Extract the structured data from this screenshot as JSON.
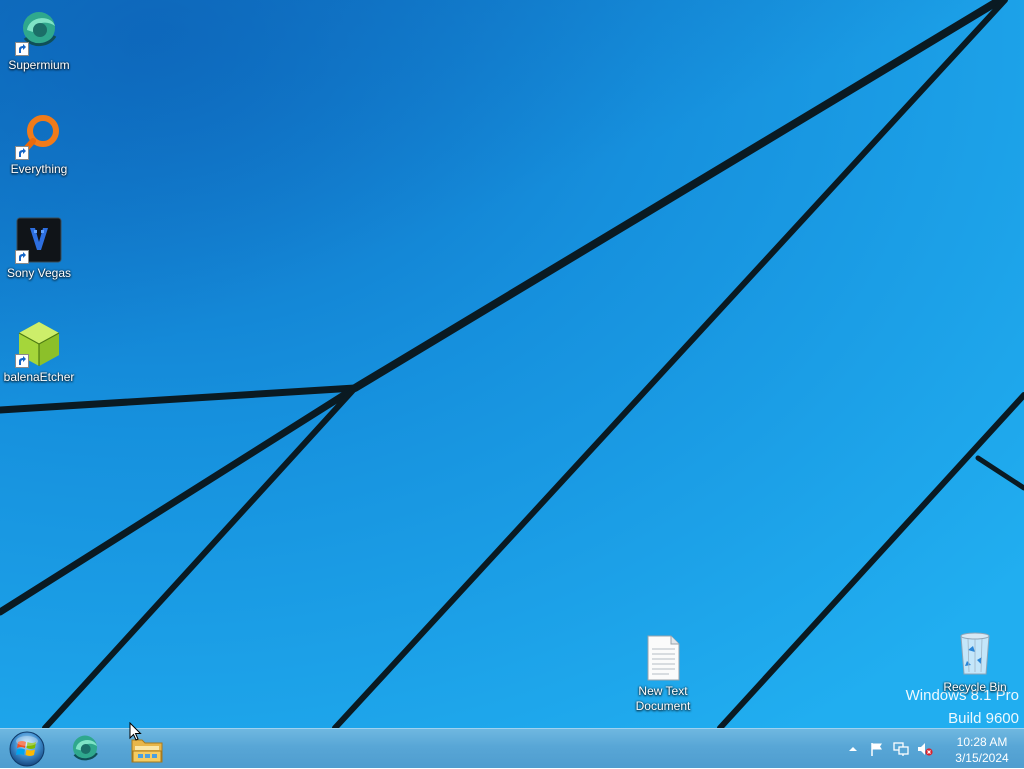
{
  "desktop": {
    "icons": [
      {
        "label": "Supermium",
        "icon": "supermium-icon"
      },
      {
        "label": "Everything",
        "icon": "everything-search-icon"
      },
      {
        "label": "Sony Vegas",
        "icon": "sony-vegas-icon"
      },
      {
        "label": "balenaEtcher",
        "icon": "balena-etcher-icon"
      },
      {
        "label": "New Text Document",
        "icon": "text-document-icon"
      },
      {
        "label": "Recycle Bin",
        "icon": "recycle-bin-icon"
      }
    ],
    "watermark": {
      "line1": "Windows 8.1 Pro",
      "line2": "Build 9600"
    }
  },
  "taskbar": {
    "start_icon": "windows-start-orb-icon",
    "pinned": [
      {
        "name": "supermium",
        "icon": "supermium-icon"
      },
      {
        "name": "file-explorer",
        "icon": "file-explorer-icon"
      }
    ],
    "tray": {
      "icons": [
        "show-hidden-icons-chevron",
        "action-center-flag-icon",
        "network-icon",
        "volume-muted-icon"
      ],
      "time": "10:28 AM",
      "date": "3/15/2024"
    }
  },
  "colors": {
    "wallpaper": "#1c9fe6",
    "taskbar": "#58a6d6",
    "text": "#ffffff"
  }
}
